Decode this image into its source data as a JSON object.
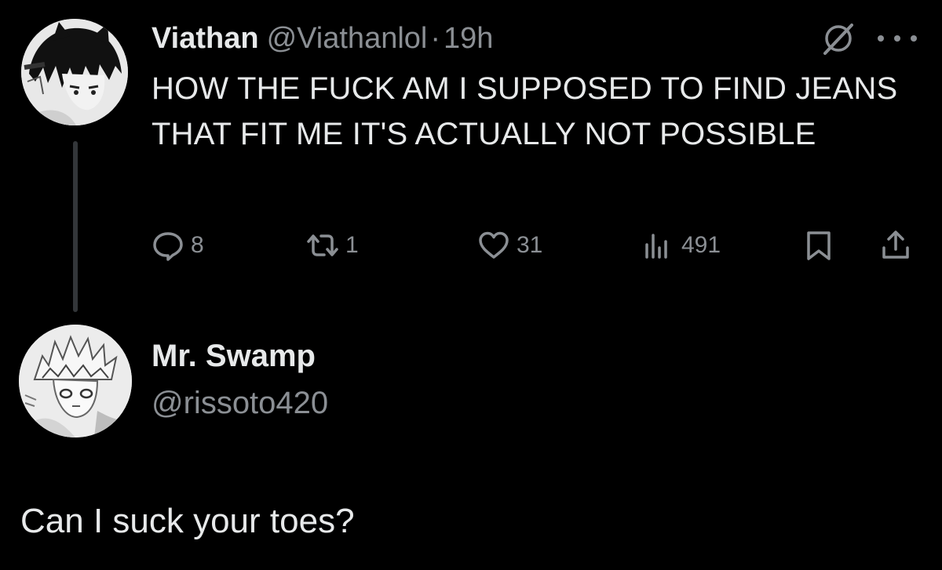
{
  "tweet": {
    "author": {
      "display_name": "Viathan",
      "handle": "@Viathanlol",
      "avatar_icon": "anime-character-avatar"
    },
    "separator": "·",
    "time": "19h",
    "text": "HOW THE FUCK AM I SUPPOSED TO FIND JEANS THAT FIT ME IT'S ACTUALLY NOT POSSIBLE",
    "actions": {
      "replies": "8",
      "reposts": "1",
      "likes": "31",
      "views": "491"
    },
    "icons": {
      "grok": "grok-icon",
      "more": "more-icon",
      "reply": "reply-icon",
      "repost": "repost-icon",
      "like": "heart-icon",
      "views": "views-icon",
      "bookmark": "bookmark-icon",
      "share": "share-icon"
    }
  },
  "reply": {
    "author": {
      "display_name": "Mr. Swamp",
      "handle": "@rissoto420",
      "avatar_icon": "manga-character-avatar"
    },
    "text": "Can I suck your toes?"
  },
  "colors": {
    "background": "#000000",
    "primary_text": "#e7e9ea",
    "secondary_text": "#8b8f94",
    "thread_line": "#333639"
  }
}
